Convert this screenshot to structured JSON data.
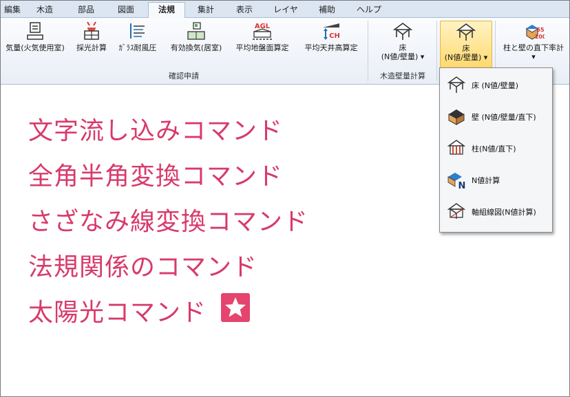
{
  "tabs": [
    {
      "label": "編集",
      "active": false
    },
    {
      "label": "木造",
      "active": false
    },
    {
      "label": "部品",
      "active": false
    },
    {
      "label": "図面",
      "active": false
    },
    {
      "label": "法規",
      "active": true
    },
    {
      "label": "集計",
      "active": false
    },
    {
      "label": "表示",
      "active": false
    },
    {
      "label": "レイヤ",
      "active": false
    },
    {
      "label": "補助",
      "active": false
    },
    {
      "label": "ヘルプ",
      "active": false
    }
  ],
  "ribbon": {
    "group1": {
      "label": "確認申請",
      "buttons": [
        "気量(火気使用室)",
        "採光計算",
        "ｶﾞﾗｽ耐風圧",
        "有効換気(居室)",
        "平均地盤面算定",
        "平均天井高算定"
      ]
    },
    "group2": {
      "label": "木造壁量計算",
      "button_line1": "床",
      "button_line2": "(N値/壁量)"
    },
    "group3": {
      "button_line1": "床",
      "button_line2": "(N値/壁量)"
    },
    "group4": {
      "button": "柱と壁の直下率計"
    },
    "icon_texts": {
      "agl": "AGL",
      "ch": "CH",
      "n55": "55",
      "n100": "100"
    }
  },
  "dropdown": {
    "items": [
      {
        "label": "床 (N値/壁量)",
        "icon": "floor-house-icon"
      },
      {
        "label": "壁 (N値/壁量/直下)",
        "icon": "wall-house-icon"
      },
      {
        "label": "柱(N値/直下)",
        "icon": "column-house-icon"
      },
      {
        "label": "N値計算",
        "icon": "n-value-icon"
      },
      {
        "label": "軸組線図(N値計算)",
        "icon": "frame-diagram-icon"
      }
    ]
  },
  "content": {
    "lines": [
      "文字流し込みコマンド",
      "全角半角変換コマンド",
      "さざなみ線変換コマンド",
      "法規関係のコマンド",
      "太陽光コマンド"
    ],
    "accent_color": "#d83a6b"
  }
}
